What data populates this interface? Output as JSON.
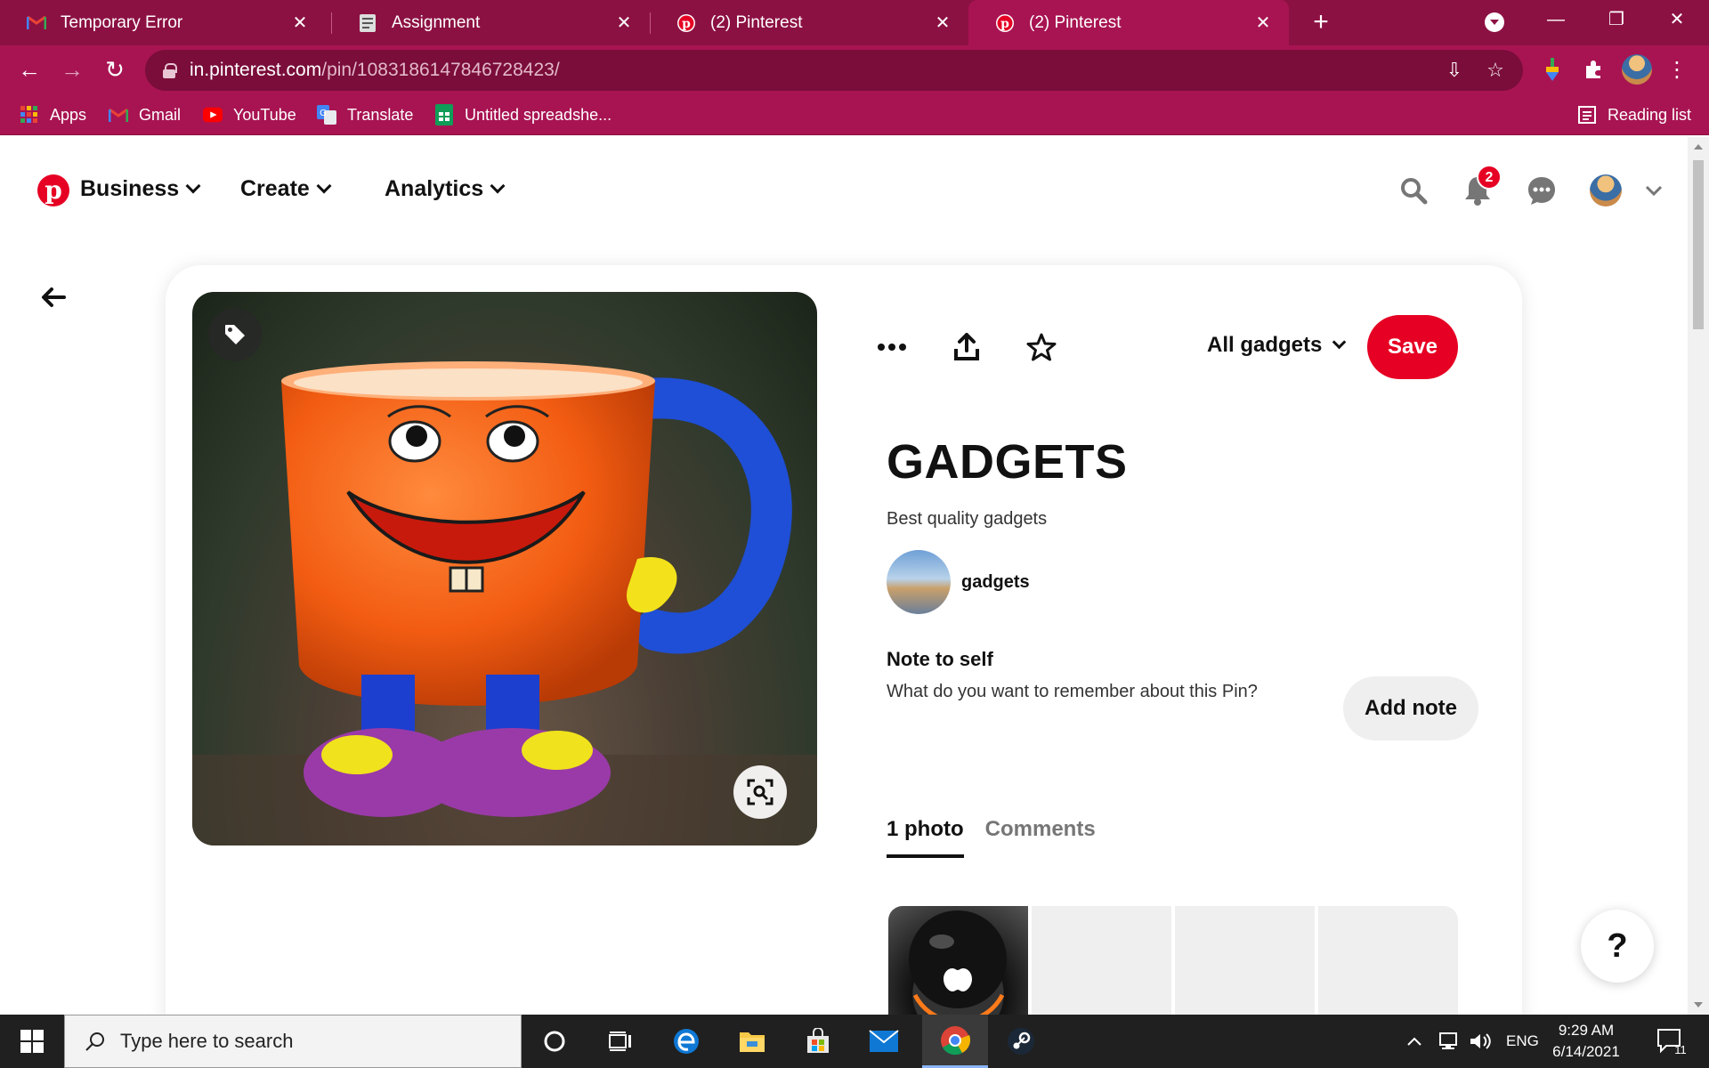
{
  "browser": {
    "tabs": [
      {
        "title": "Temporary Error",
        "icon": "gmail-icon"
      },
      {
        "title": "Assignment",
        "icon": "doc-icon"
      },
      {
        "title": "(2) Pinterest",
        "icon": "pinterest-icon"
      },
      {
        "title": "(2) Pinterest",
        "icon": "pinterest-icon",
        "active": true
      }
    ],
    "url_host": "in.pinterest.com",
    "url_path": "/pin/1083186147846728423/",
    "bookmarks": [
      {
        "label": "Apps",
        "icon": "apps-grid-icon"
      },
      {
        "label": "Gmail",
        "icon": "gmail-icon"
      },
      {
        "label": "YouTube",
        "icon": "youtube-icon"
      },
      {
        "label": "Translate",
        "icon": "translate-icon"
      },
      {
        "label": "Untitled spreadshe...",
        "icon": "sheets-icon"
      }
    ],
    "reading_list": "Reading list",
    "colors": {
      "frame": "#8c1143",
      "toolbar": "#a81452",
      "omnibox": "#7a0d3a"
    }
  },
  "pinterest": {
    "nav": {
      "business": "Business",
      "create": "Create",
      "analytics": "Analytics"
    },
    "notification_count": "2",
    "board": "All gadgets",
    "save": "Save",
    "title": "GADGETS",
    "description": "Best quality gadgets",
    "creator": "gadgets",
    "note_title": "Note to self",
    "note_prompt": "What do you want to remember about this Pin?",
    "add_note": "Add note",
    "tabs": [
      "1 photo",
      "Comments"
    ],
    "help": "?",
    "brand_color": "#e60023"
  },
  "taskbar": {
    "search_placeholder": "Type here to search",
    "language": "ENG",
    "time": "9:29 AM",
    "date": "6/14/2021",
    "notification_count": "11"
  }
}
